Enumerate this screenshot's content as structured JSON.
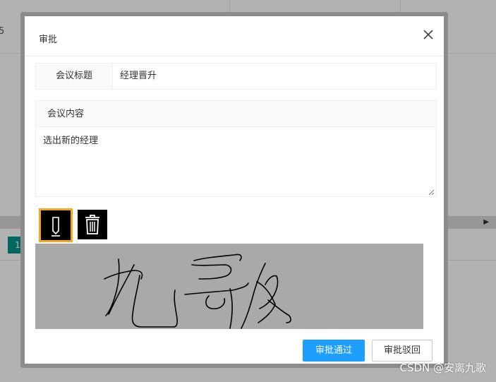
{
  "background": {
    "left_number": "5",
    "badge": "1"
  },
  "dialog": {
    "title": "审批",
    "close_icon": "close-icon",
    "title_field": {
      "label": "会议标题",
      "value": "经理晋升"
    },
    "content_field": {
      "label": "会议内容",
      "value": "选出新的经理"
    },
    "tools": {
      "pen_icon": "pen-icon",
      "trash_icon": "trash-icon"
    },
    "signature_colors": {
      "canvas": "#a9a9a9",
      "stroke": "#000000"
    },
    "buttons": {
      "approve": "审批通过",
      "reject": "审批驳回"
    },
    "colors": {
      "primary": "#1e9fff",
      "pen_border": "#f5a623"
    }
  },
  "watermark": "CSDN @安离九歌"
}
